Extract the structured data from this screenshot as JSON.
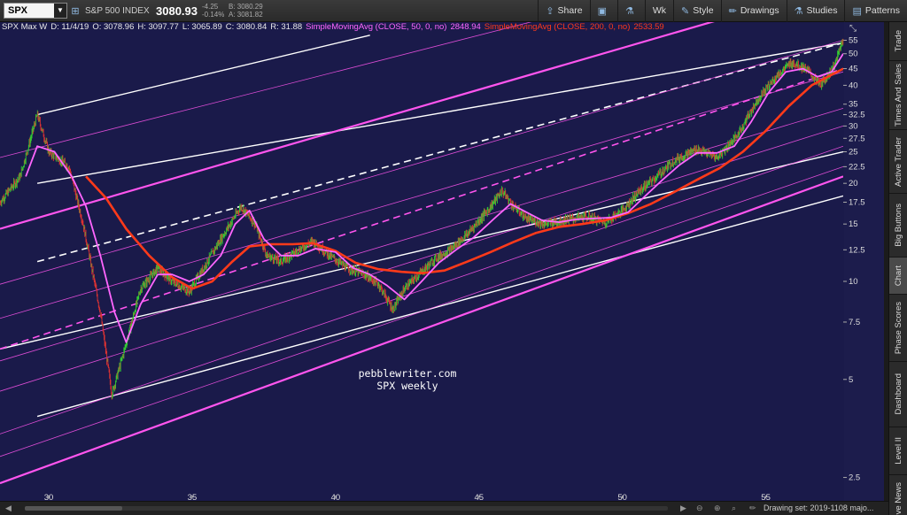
{
  "toolbar": {
    "symbol": "SPX",
    "index_name": "S&P 500 INDEX",
    "price": "3080.93",
    "change": "-4.25",
    "change_pct": "-0.14%",
    "bid": "B: 3080.29",
    "ask": "A: 3081.82",
    "buttons": [
      "Share",
      "Wk",
      "Style",
      "Drawings",
      "Studies",
      "Patterns"
    ]
  },
  "chart_header": {
    "name": "SPX Max W",
    "date": "D: 11/4/19",
    "open": "O: 3078.96",
    "high": "H: 3097.77",
    "low": "L: 3065.89",
    "close": "C: 3080.84",
    "range": "R: 31.88",
    "sma50_label": "SimpleMovingAvg (CLOSE, 50, 0, no)",
    "sma50_value": "2848.94",
    "sma200_label": "SimpleMovingAvg (CLOSE, 200, 0, no)",
    "sma200_value": "2533.59"
  },
  "watermark": {
    "line1": "pebblewriter.com",
    "line2": "SPX weekly"
  },
  "rail_tabs": [
    "Trade",
    "Times And Sales",
    "Active Trader",
    "Big Buttons",
    "Chart",
    "Phase Scores",
    "Dashboard",
    "Level II",
    "Live News"
  ],
  "active_rail_tab": "Chart",
  "bottom": {
    "drawing_set": "Drawing set: 2019-1108 majo..."
  },
  "colors": {
    "background": "#1a1a4a",
    "candle_up": "#33cc33",
    "candle_down": "#dd3333",
    "sma50": "#ff66ff",
    "sma200": "#ff3a1a",
    "channel_magenta": "#ff55ee",
    "channel_white": "#ffffff"
  },
  "chart_data": {
    "type": "candlestick",
    "y_scale": "log",
    "ylim": [
      2.2,
      58
    ],
    "xlim": [
      28.3,
      57.7
    ],
    "x_ticks": [
      30,
      35,
      40,
      45,
      50,
      55
    ],
    "y_ticks": [
      2.5,
      5,
      7.5,
      10,
      12.5,
      15,
      17.5,
      20,
      22.5,
      25,
      27.5,
      30,
      32.5,
      35,
      40,
      45,
      50,
      55
    ],
    "price_path": [
      [
        28.3,
        17.5
      ],
      [
        29.0,
        21
      ],
      [
        29.6,
        32.5
      ],
      [
        30.0,
        25
      ],
      [
        30.7,
        22.5
      ],
      [
        31.2,
        15
      ],
      [
        31.8,
        8
      ],
      [
        32.2,
        4.5
      ],
      [
        32.6,
        6
      ],
      [
        33.2,
        9.5
      ],
      [
        33.8,
        11
      ],
      [
        34.3,
        10
      ],
      [
        34.9,
        9.3
      ],
      [
        35.4,
        11
      ],
      [
        36.0,
        13.5
      ],
      [
        36.7,
        17
      ],
      [
        37.2,
        15
      ],
      [
        37.6,
        12
      ],
      [
        38.1,
        11.5
      ],
      [
        38.6,
        12.3
      ],
      [
        39.2,
        13.3
      ],
      [
        39.8,
        12
      ],
      [
        40.4,
        11
      ],
      [
        41.0,
        10.5
      ],
      [
        41.5,
        9.8
      ],
      [
        42.0,
        8.2
      ],
      [
        42.4,
        9.5
      ],
      [
        42.9,
        10.5
      ],
      [
        43.5,
        11.8
      ],
      [
        44.0,
        12.5
      ],
      [
        44.6,
        14
      ],
      [
        45.3,
        16.5
      ],
      [
        45.8,
        19
      ],
      [
        46.2,
        17
      ],
      [
        46.7,
        15.5
      ],
      [
        47.3,
        15
      ],
      [
        47.8,
        15.3
      ],
      [
        48.3,
        15.6
      ],
      [
        48.8,
        15.8
      ],
      [
        49.4,
        15.2
      ],
      [
        50.0,
        16.5
      ],
      [
        50.6,
        19
      ],
      [
        51.2,
        21
      ],
      [
        51.8,
        23.5
      ],
      [
        52.6,
        25.5
      ],
      [
        53.3,
        24
      ],
      [
        54.0,
        28
      ],
      [
        54.7,
        36
      ],
      [
        55.3,
        42
      ],
      [
        55.9,
        47
      ],
      [
        56.4,
        45
      ],
      [
        56.9,
        40
      ],
      [
        57.4,
        46
      ],
      [
        57.7,
        56
      ]
    ],
    "sma50_path": [
      [
        29.2,
        21
      ],
      [
        29.6,
        26
      ],
      [
        30.2,
        25
      ],
      [
        30.8,
        21
      ],
      [
        31.3,
        17
      ],
      [
        31.8,
        12
      ],
      [
        32.3,
        8
      ],
      [
        32.7,
        6.5
      ],
      [
        33.2,
        8.5
      ],
      [
        33.8,
        10.5
      ],
      [
        34.3,
        10.5
      ],
      [
        34.9,
        10
      ],
      [
        35.4,
        10.5
      ],
      [
        36.0,
        12
      ],
      [
        36.5,
        15
      ],
      [
        37.0,
        16.5
      ],
      [
        37.5,
        13.5
      ],
      [
        38.1,
        12
      ],
      [
        38.7,
        12
      ],
      [
        39.3,
        12.6
      ],
      [
        40.0,
        12.3
      ],
      [
        40.6,
        11
      ],
      [
        41.2,
        10.5
      ],
      [
        41.8,
        9.7
      ],
      [
        42.4,
        8.8
      ],
      [
        43.0,
        10
      ],
      [
        43.6,
        11.4
      ],
      [
        44.2,
        12.5
      ],
      [
        44.8,
        13.6
      ],
      [
        45.5,
        15.5
      ],
      [
        46.1,
        17.3
      ],
      [
        46.6,
        16.4
      ],
      [
        47.2,
        15.4
      ],
      [
        47.8,
        15.2
      ],
      [
        48.4,
        15.5
      ],
      [
        49.0,
        15.6
      ],
      [
        49.6,
        15.7
      ],
      [
        50.2,
        16.3
      ],
      [
        50.8,
        18.3
      ],
      [
        51.4,
        20.5
      ],
      [
        52.0,
        22.8
      ],
      [
        52.6,
        24.8
      ],
      [
        53.3,
        24.8
      ],
      [
        53.9,
        26
      ],
      [
        54.5,
        31
      ],
      [
        55.1,
        38
      ],
      [
        55.7,
        44
      ],
      [
        56.3,
        45
      ],
      [
        56.8,
        42.5
      ],
      [
        57.3,
        44
      ],
      [
        57.7,
        50
      ]
    ],
    "sma200_path": [
      [
        31.3,
        21
      ],
      [
        32.0,
        18
      ],
      [
        32.7,
        14.5
      ],
      [
        33.5,
        12
      ],
      [
        34.3,
        10.3
      ],
      [
        35.0,
        9.5
      ],
      [
        35.7,
        10
      ],
      [
        36.4,
        11.5
      ],
      [
        37.0,
        12.8
      ],
      [
        37.7,
        13
      ],
      [
        38.5,
        13
      ],
      [
        39.2,
        13.1
      ],
      [
        40.0,
        12.4
      ],
      [
        40.7,
        11.4
      ],
      [
        41.5,
        10.9
      ],
      [
        42.3,
        10.7
      ],
      [
        43.0,
        10.6
      ],
      [
        43.8,
        10.8
      ],
      [
        44.6,
        11.5
      ],
      [
        45.4,
        12.3
      ],
      [
        46.2,
        13.2
      ],
      [
        47.0,
        14.1
      ],
      [
        47.8,
        14.7
      ],
      [
        48.6,
        15
      ],
      [
        49.4,
        15.4
      ],
      [
        50.2,
        16.2
      ],
      [
        51.0,
        17.3
      ],
      [
        51.8,
        18.8
      ],
      [
        52.6,
        20.5
      ],
      [
        53.4,
        22.3
      ],
      [
        54.2,
        25
      ],
      [
        55.0,
        29
      ],
      [
        55.8,
        34.5
      ],
      [
        56.6,
        40
      ],
      [
        57.7,
        45
      ]
    ],
    "channels": [
      {
        "style": "white-solid",
        "from": [
          29.6,
          32.5
        ],
        "to": [
          41.2,
          57
        ]
      },
      {
        "style": "white-solid",
        "from": [
          29.6,
          20
        ],
        "to": [
          57.7,
          54
        ]
      },
      {
        "style": "white-solid",
        "from": [
          28.3,
          6.2
        ],
        "to": [
          57.7,
          25
        ]
      },
      {
        "style": "white-solid",
        "from": [
          29.6,
          3.85
        ],
        "to": [
          57.7,
          18.3
        ]
      },
      {
        "style": "white-dashed",
        "from": [
          29.6,
          11.5
        ],
        "to": [
          57.7,
          54
        ]
      },
      {
        "style": "magenta-dashed",
        "from": [
          28.3,
          6.2
        ],
        "to": [
          57.7,
          45
        ]
      },
      {
        "style": "magenta-thick",
        "from": [
          28.3,
          14.5
        ],
        "to": [
          57.7,
          82
        ]
      },
      {
        "style": "magenta-thick",
        "from": [
          28.3,
          2.4
        ],
        "to": [
          57.7,
          21
        ]
      },
      {
        "style": "magenta-thin",
        "from": [
          28.3,
          9.8
        ],
        "to": [
          57.7,
          55
        ]
      },
      {
        "style": "magenta-thin",
        "from": [
          28.3,
          7.7
        ],
        "to": [
          57.7,
          44
        ]
      },
      {
        "style": "magenta-thin",
        "from": [
          28.3,
          5.7
        ],
        "to": [
          57.7,
          34
        ]
      },
      {
        "style": "magenta-thin",
        "from": [
          28.3,
          4.6
        ],
        "to": [
          57.7,
          30
        ]
      },
      {
        "style": "magenta-thin",
        "from": [
          28.3,
          3.4
        ],
        "to": [
          57.7,
          26
        ]
      },
      {
        "style": "magenta-thin",
        "from": [
          28.3,
          24
        ],
        "to": [
          57.7,
          110
        ]
      },
      {
        "style": "magenta-thin",
        "from": [
          28.3,
          2.9
        ],
        "to": [
          57.7,
          22.5
        ]
      }
    ]
  }
}
